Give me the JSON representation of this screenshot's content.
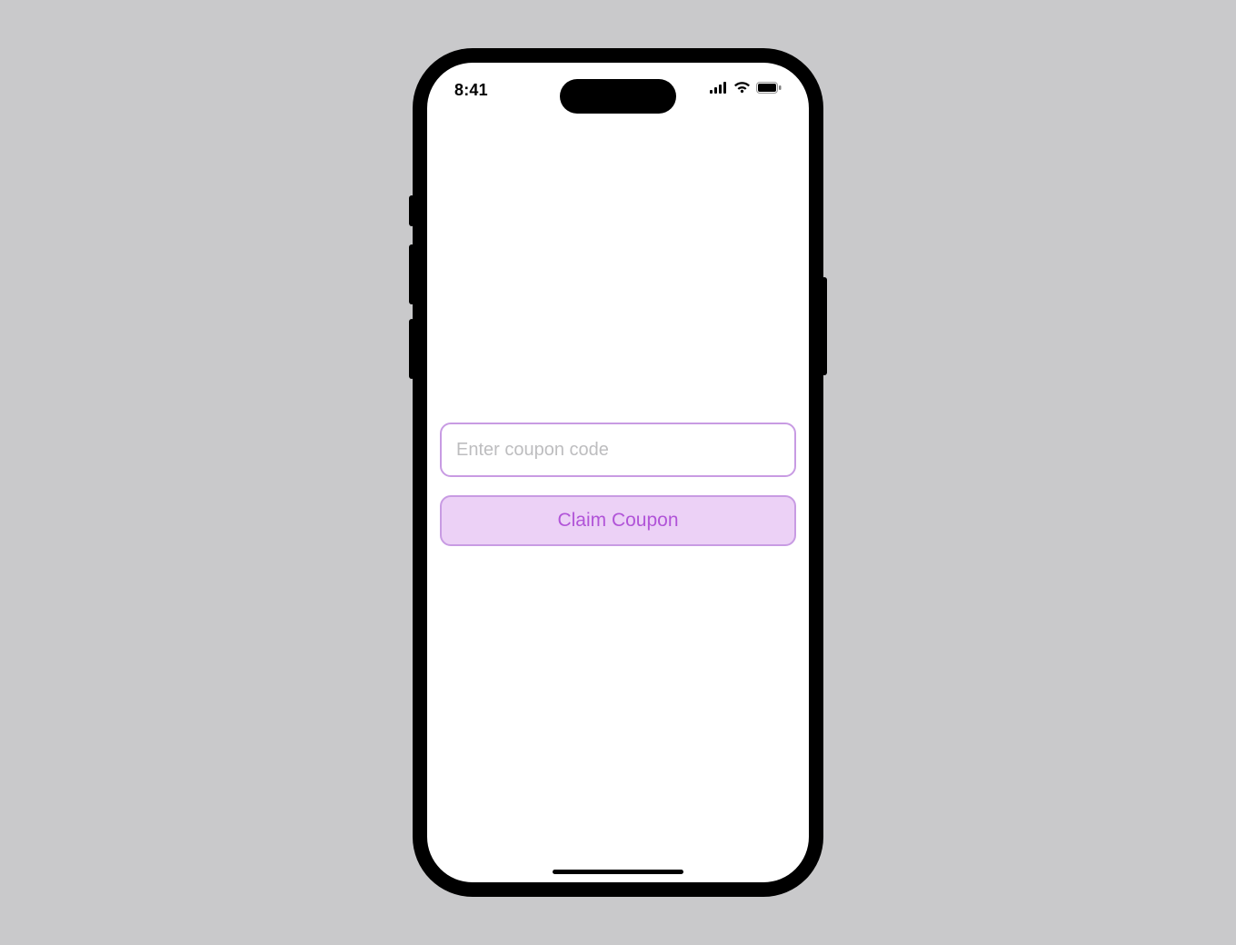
{
  "status": {
    "time": "8:41"
  },
  "coupon": {
    "placeholder": "Enter coupon code",
    "value": "",
    "button_label": "Claim Coupon"
  },
  "colors": {
    "accent_border": "#c89be3",
    "button_fill": "#ecd1f6",
    "button_text": "#b154d8"
  }
}
